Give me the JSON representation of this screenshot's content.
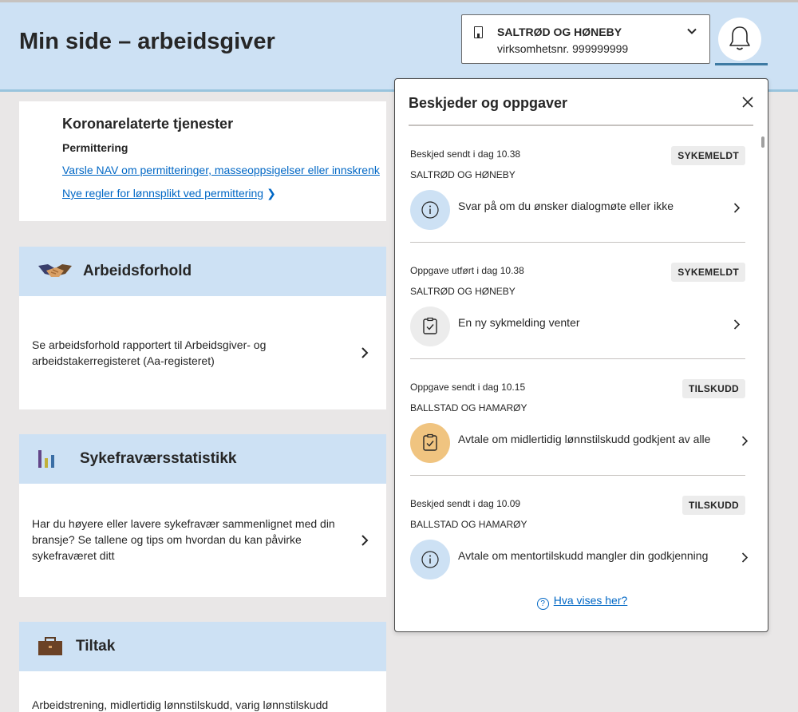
{
  "header": {
    "title": "Min side – arbeidsgiver",
    "org_name": "SALTRØD OG HØNEBY",
    "org_number": "virksomhetsnr. 999999999"
  },
  "corona": {
    "title": "Koronarelaterte tjenester",
    "subtitle": "Permittering",
    "link1": "Varsle NAV om permitteringer, masseoppsigelser eller innskrenk",
    "link2": "Nye regler for lønnsplikt ved permittering"
  },
  "panels": [
    {
      "title": "Arbeidsforhold",
      "text": "Se arbeidsforhold rapportert til Arbeidsgiver- og arbeidstakerregisteret (Aa-registeret)",
      "icon": "handshake-icon"
    },
    {
      "title": "Sykefraværsstatistikk",
      "text": "Har du høyere eller lavere sykefravær sammenlignet med din bransje? Se tallene og tips om hvordan du kan påvirke sykefraværet ditt",
      "icon": "bar-chart-icon"
    },
    {
      "title": "Tiltak",
      "text": "Arbeidstrening, midlertidig lønnstilskudd, varig lønnstilskudd",
      "icon": "briefcase-icon"
    }
  ],
  "notifications": {
    "title": "Beskjeder og oppgaver",
    "footer_link": "Hva vises her?",
    "items": [
      {
        "meta": "Beskjed sendt i dag 10.38",
        "org": "SALTRØD OG HØNEBY",
        "badge": "SYKEMELDT",
        "text": "Svar på om du ønsker dialogmøte eller ikke",
        "icon": "info-icon",
        "icon_bg": "#cde1f4"
      },
      {
        "meta": "Oppgave utført i dag 10.38",
        "org": "SALTRØD OG HØNEBY",
        "badge": "SYKEMELDT",
        "text": "En ny sykmelding venter",
        "icon": "task-done-icon",
        "icon_bg": "#ececec"
      },
      {
        "meta": "Oppgave sendt i dag 10.15",
        "org": "BALLSTAD OG HAMARØY",
        "badge": "TILSKUDD",
        "text": "Avtale om midlertidig lønnstilskudd godkjent av alle",
        "icon": "task-icon",
        "icon_bg": "#f0c480"
      },
      {
        "meta": "Beskjed sendt i dag 10.09",
        "org": "BALLSTAD OG HAMARØY",
        "badge": "TILSKUDD",
        "text": "Avtale om mentortilskudd mangler din godkjenning",
        "icon": "info-icon",
        "icon_bg": "#cde1f4"
      }
    ]
  }
}
